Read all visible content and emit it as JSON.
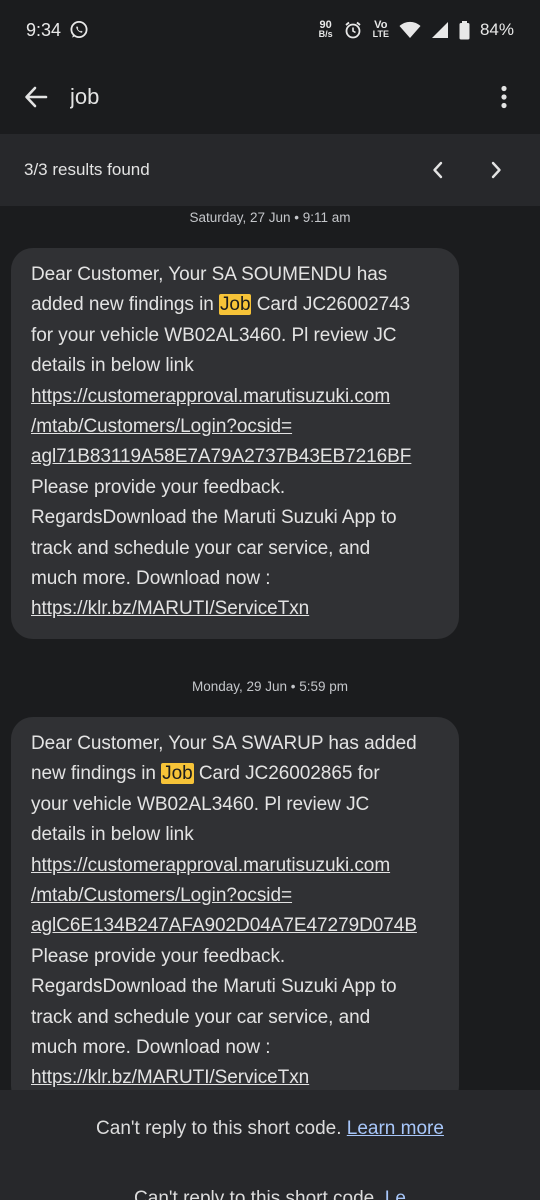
{
  "status_bar": {
    "time": "9:34",
    "data_rate_value": "90",
    "data_rate_unit": "B/s",
    "volte_top": "Vo",
    "volte_bottom": "LTE",
    "battery": "84%"
  },
  "app_bar": {
    "search_query": "job"
  },
  "results": {
    "summary": "3/3 results found"
  },
  "messages": [
    {
      "date": "Saturday, 27 Jun • 9:11 am",
      "lines": {
        "l1": "Dear Customer, Your SA SOUMENDU has",
        "l2a": "added new findings in ",
        "l2hl": "Job",
        "l2b": " Card JC26002743",
        "l3": "for your vehicle WB02AL3460. Pl review JC",
        "l4": "details in below link",
        "l5": "https://customerapproval.marutisuzuki.com",
        "l6": "/mtab/Customers/Login?ocsid=",
        "l7": "agl71B83119A58E7A79A2737B43EB7216BF",
        "l8": "Please provide your feedback.",
        "l9": "RegardsDownload the Maruti Suzuki App to",
        "l10": "track and schedule your car service, and",
        "l11": "much more. Download now :",
        "l12": "https://klr.bz/MARUTI/ServiceTxn"
      }
    },
    {
      "date": "Monday, 29 Jun • 5:59 pm",
      "lines": {
        "l1": "Dear Customer, Your SA SWARUP has added",
        "l2a": "new findings in ",
        "l2hl": "Job",
        "l2b": " Card JC26002865 for",
        "l3": "your vehicle WB02AL3460. Pl review JC",
        "l4": "details in below link",
        "l5": "https://customerapproval.marutisuzuki.com",
        "l6": "/mtab/Customers/Login?ocsid=",
        "l7": "aglC6E134B247AFA902D04A7E47279D074B",
        "l8": "Please provide your feedback.",
        "l9": "RegardsDownload the Maruti Suzuki App to",
        "l10": "track and schedule your car service, and",
        "l11": "much more. Download now :",
        "l12": "https://klr.bz/MARUTI/ServiceTxn"
      }
    }
  ],
  "footer": {
    "notice": "Can't reply to this short code. ",
    "learn_more": "Learn more",
    "notice_repeat": "Can't reply to this short code. ",
    "learn_more_repeat": "Le"
  },
  "icons": {
    "status": [
      "whatsapp-icon",
      "alarm-icon",
      "wifi-icon",
      "signal-icon",
      "battery-icon"
    ],
    "app_bar": [
      "back-arrow-icon",
      "more-vert-icon"
    ],
    "results": [
      "chevron-left-icon",
      "chevron-right-icon"
    ]
  }
}
